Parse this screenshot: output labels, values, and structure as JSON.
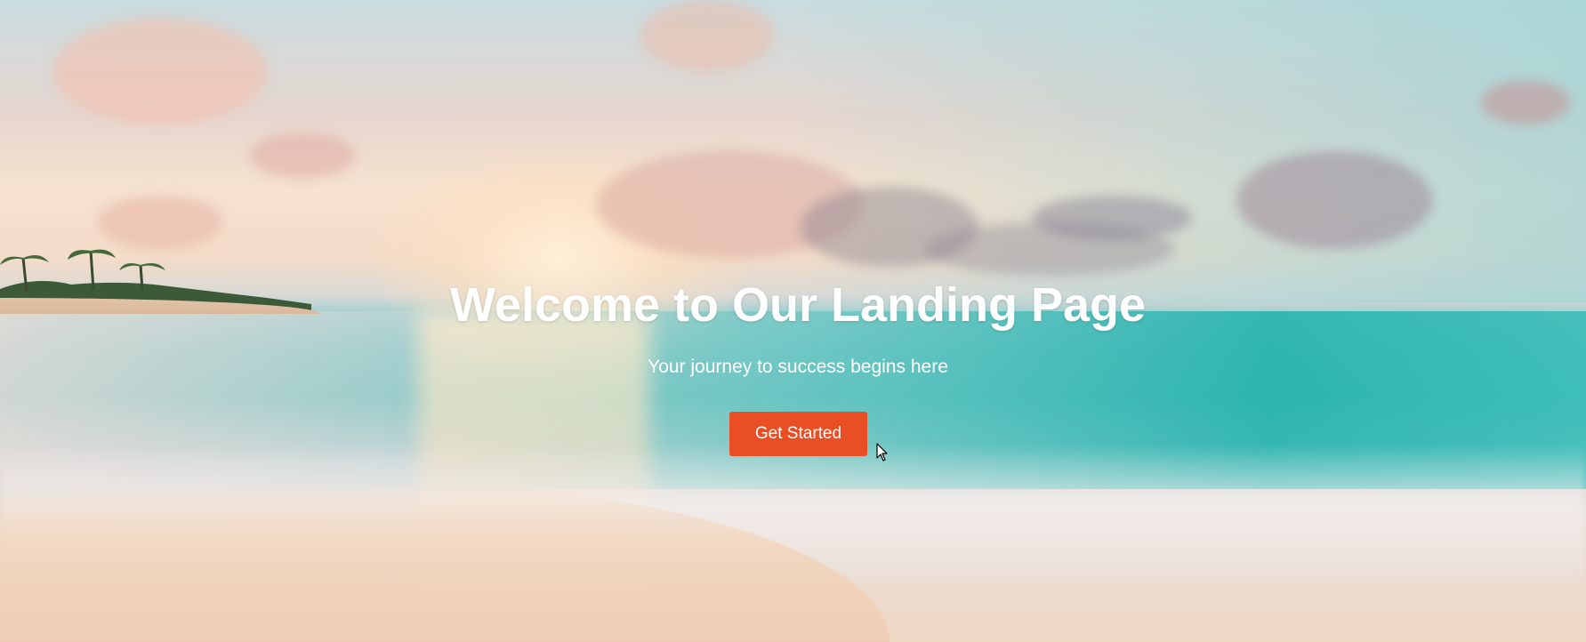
{
  "hero": {
    "title": "Welcome to Our Landing Page",
    "subtitle": "Your journey to success begins here",
    "cta_label": "Get Started",
    "background_image": "beach-sunset-image"
  },
  "colors": {
    "cta_background": "#ea4e25",
    "text": "#ffffff"
  }
}
